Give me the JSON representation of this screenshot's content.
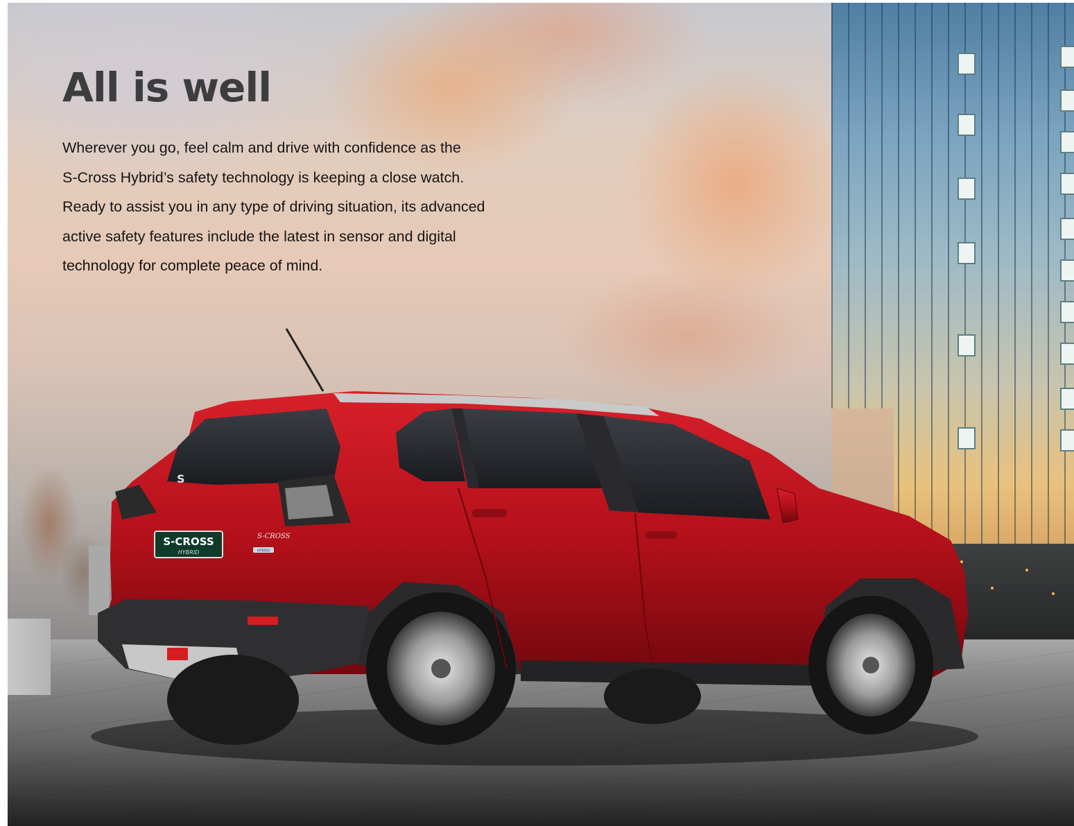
{
  "hero": {
    "headline": "All is well",
    "body_lines": [
      "Wherever you go, feel calm and drive with confidence as the",
      "S-Cross Hybrid’s safety technology is keeping a close watch.",
      "Ready to assist you in any type of driving situation, its advanced",
      "active safety features include the latest in sensor and digital",
      "technology for complete peace of mind."
    ],
    "badge": {
      "model": "S-CROSS",
      "variant": "HYBRID"
    },
    "tailgate_script": "S-CROSS",
    "tailgate_small_badge": "HYBRID"
  },
  "colors": {
    "headline": "#3d3d3f",
    "body": "#151515",
    "car_red": "#b3101a"
  }
}
